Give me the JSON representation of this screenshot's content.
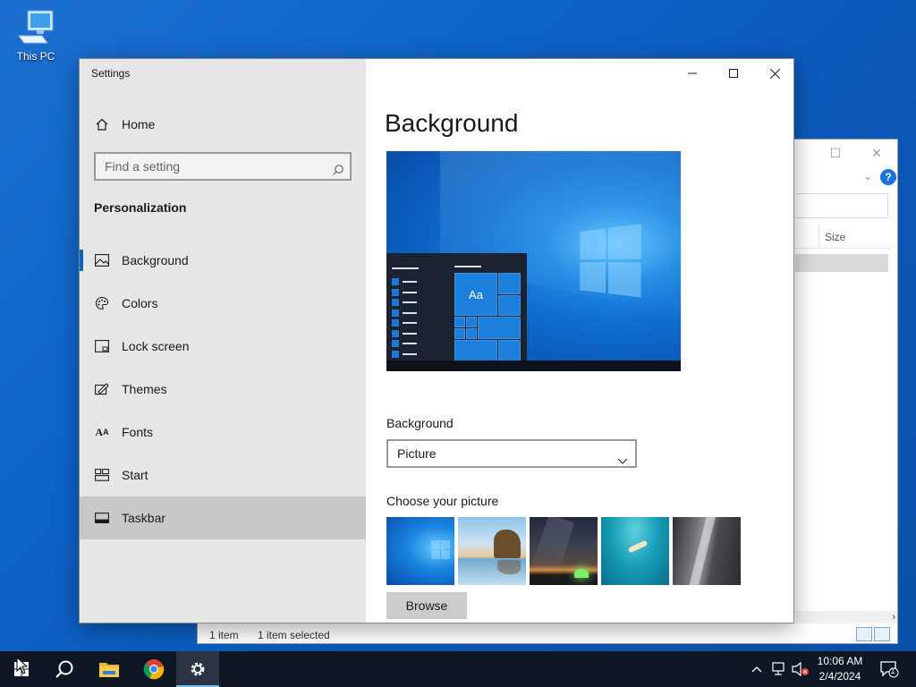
{
  "desktop": {
    "this_pc_label": "This PC"
  },
  "explorer": {
    "column_size": "Size",
    "status_count": "1 item",
    "status_selected": "1 item selected",
    "help": "?"
  },
  "settings": {
    "app_title": "Settings",
    "home_label": "Home",
    "search_placeholder": "Find a setting",
    "section_label": "Personalization",
    "nav": [
      {
        "label": "Background",
        "icon": "picture-icon"
      },
      {
        "label": "Colors",
        "icon": "palette-icon"
      },
      {
        "label": "Lock screen",
        "icon": "lock-screen-icon"
      },
      {
        "label": "Themes",
        "icon": "brush-icon"
      },
      {
        "label": "Fonts",
        "icon": "font-icon"
      },
      {
        "label": "Start",
        "icon": "start-icon"
      },
      {
        "label": "Taskbar",
        "icon": "taskbar-icon"
      }
    ],
    "selected_nav": "Taskbar",
    "active_nav": "Background",
    "page_title": "Background",
    "preview_tile_text": "Aa",
    "background_label": "Background",
    "background_value": "Picture",
    "choose_picture_label": "Choose your picture",
    "browse_label": "Browse",
    "accent_color": "#0067c0"
  },
  "taskbar": {
    "time": "10:06 AM",
    "date": "2/4/2024",
    "notification_count": "1",
    "apps": [
      "start-icon",
      "search-icon",
      "file-explorer-icon",
      "chrome-icon",
      "settings-icon"
    ]
  }
}
